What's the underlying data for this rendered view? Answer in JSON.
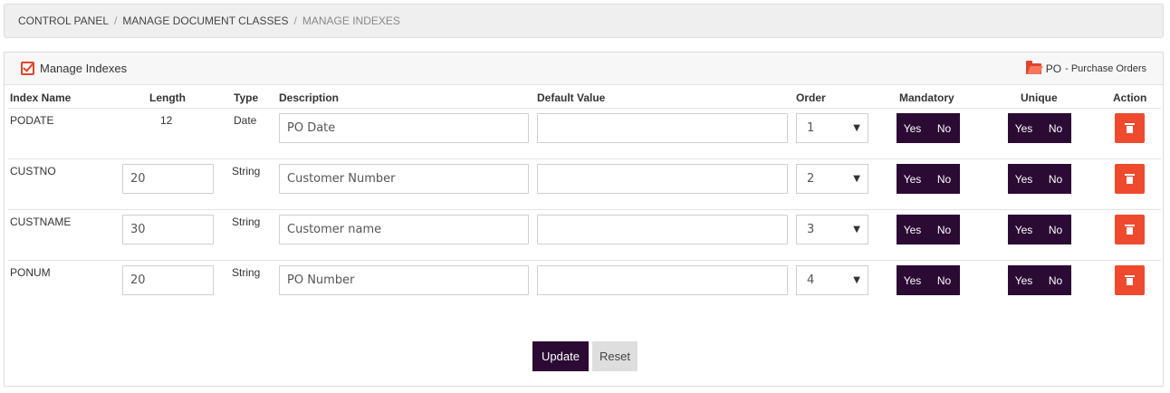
{
  "breadcrumb": {
    "items": [
      "CONTROL PANEL",
      "MANAGE DOCUMENT CLASSES",
      "MANAGE INDEXES"
    ],
    "separator": "/"
  },
  "panel": {
    "title": "Manage Indexes",
    "document_class": "PO",
    "document_class_name": "- Purchase Orders"
  },
  "columns": {
    "index_name": "Index Name",
    "length": "Length",
    "type": "Type",
    "description": "Description",
    "default_value": "Default Value",
    "order": "Order",
    "mandatory": "Mandatory",
    "unique": "Unique",
    "action": "Action"
  },
  "rows": [
    {
      "name": "PODATE",
      "length": "12",
      "type": "Date",
      "description": "PO Date",
      "default_value": "",
      "order": "1",
      "yes": "Yes",
      "no": "No"
    },
    {
      "name": "CUSTNO",
      "length": "20",
      "type": "String",
      "description": "Customer Number",
      "default_value": "",
      "order": "2",
      "yes": "Yes",
      "no": "No"
    },
    {
      "name": "CUSTNAME",
      "length": "30",
      "type": "String",
      "description": "Customer name",
      "default_value": "",
      "order": "3",
      "yes": "Yes",
      "no": "No"
    },
    {
      "name": "PONUM",
      "length": "20",
      "type": "String",
      "description": "PO Number",
      "default_value": "",
      "order": "4",
      "yes": "Yes",
      "no": "No"
    }
  ],
  "buttons": {
    "update": "Update",
    "reset": "Reset"
  },
  "colors": {
    "accent_dark": "#2b0a33",
    "danger": "#ef4a2d"
  },
  "icons": {
    "title_icon": "checkbox-checked-icon",
    "class_icon": "folder-open-icon",
    "delete_icon": "trash-icon",
    "select_arrow": "caret-down-icon"
  }
}
